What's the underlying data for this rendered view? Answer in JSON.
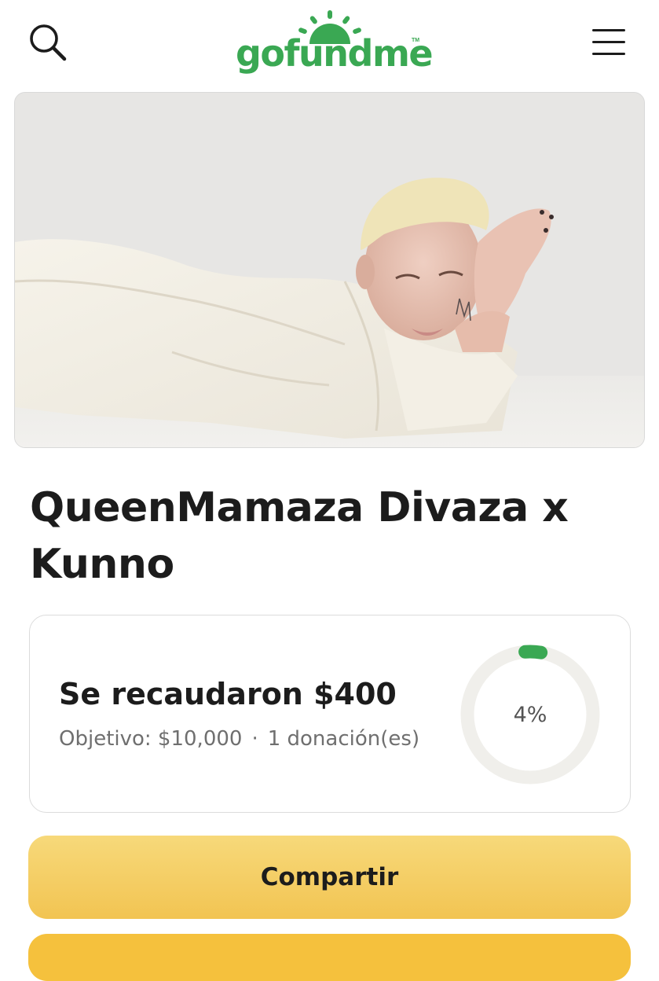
{
  "header": {
    "logo_text": "gofundme",
    "logo_tm": "TM",
    "search_icon": "search-icon",
    "menu_icon": "hamburger-menu-icon",
    "brand_color": "#3aa853"
  },
  "campaign": {
    "title": "QueenMamaza Divaza x Kunno",
    "image_description_icon": "campaign-photo"
  },
  "progress": {
    "raised_label": "Se recaudaron $400",
    "goal_label": "Objetivo: $10,000",
    "separator": "·",
    "donations_label": "1 donación(es)",
    "percent_label": "4%",
    "percent_value": 4,
    "ring_color": "#3aa853",
    "ring_track_color": "#f0efeb"
  },
  "actions": {
    "share_label": "Compartir",
    "share_color": "#f2c452",
    "donate_color": "#f5c13d"
  }
}
